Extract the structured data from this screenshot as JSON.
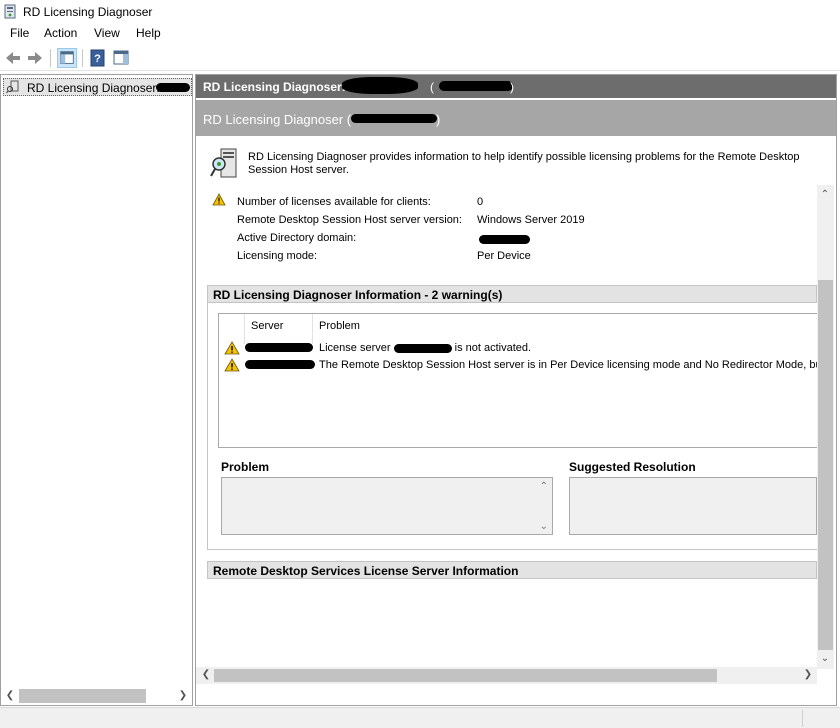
{
  "window": {
    "title": "RD Licensing Diagnoser",
    "app_icon": "rd-licensing-icon"
  },
  "menu": {
    "items": [
      "File",
      "Action",
      "View",
      "Help"
    ]
  },
  "toolbar": {
    "icons": [
      "back-arrow-icon",
      "forward-arrow-icon",
      "show-hide-console-tree-icon",
      "help-icon",
      "show-hide-action-pane-icon"
    ]
  },
  "tree": {
    "root_label": "RD Licensing Diagnoser: "
  },
  "right_pane": {
    "header_dark": "RD Licensing Diagnoser:",
    "header_gray": "RD Licensing Diagnoser (",
    "header_gray_close": ")",
    "header_dark_paren_open": "(",
    "header_dark_paren_close": ")",
    "description": "RD Licensing Diagnoser provides information to help identify possible licensing problems for the Remote Desktop Session Host server."
  },
  "info": {
    "rows": [
      {
        "label": "Number of licenses available for clients:",
        "value": "0"
      },
      {
        "label": "Remote Desktop Session Host server version:",
        "value": "Windows Server 2019"
      },
      {
        "label": "Active Directory domain:",
        "value": ""
      },
      {
        "label": "Licensing mode:",
        "value": "Per Device"
      }
    ]
  },
  "diagnoser_section": {
    "title": "RD Licensing Diagnoser Information - 2 warning(s)",
    "columns": [
      "Server",
      "Problem"
    ],
    "rows": [
      {
        "problem_prefix": "License server ",
        "problem_suffix": "is not activated."
      },
      {
        "problem": "The Remote Desktop Session Host server is in Per Device licensing mode and No Redirector Mode, but li"
      }
    ],
    "problem_label": "Problem",
    "resolution_label": "Suggested Resolution"
  },
  "license_server_section": {
    "title": "Remote Desktop Services License Server Information"
  },
  "colors": {
    "header_dark": "#6d6d6d",
    "header_gray": "#a6a6a6",
    "section_header": "#e3e3e3",
    "warning_yellow": "#f5c400"
  }
}
